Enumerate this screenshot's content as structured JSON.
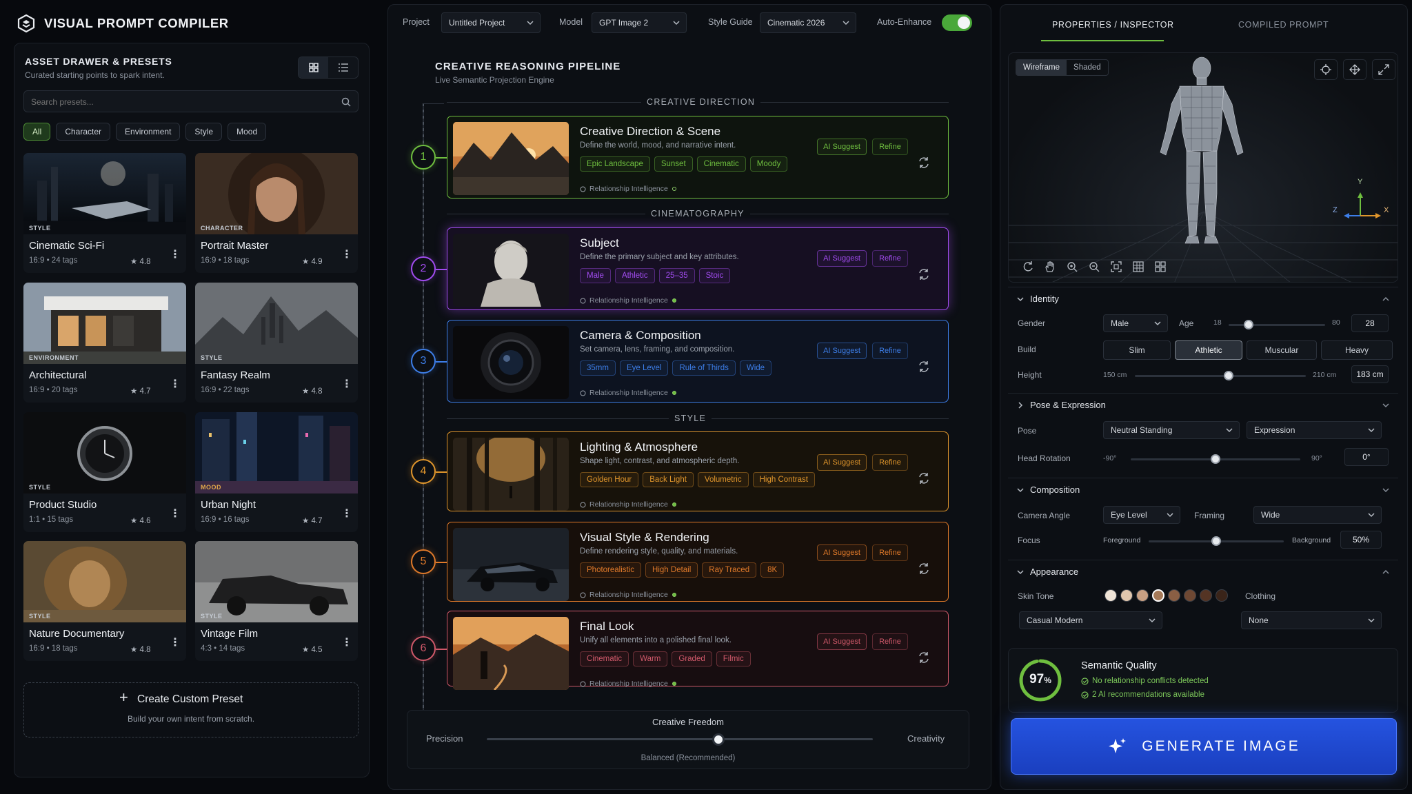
{
  "app": {
    "title": "VISUAL PROMPT COMPILER"
  },
  "drawer": {
    "title": "ASSET DRAWER & PRESETS",
    "subtitle": "Curated starting points to spark intent.",
    "search_placeholder": "Search presets...",
    "filters": [
      "All",
      "Character",
      "Environment",
      "Style",
      "Mood"
    ],
    "presets": [
      {
        "type": "STYLE",
        "title": "Cinematic Sci-Fi",
        "meta": "16:9  •  24 tags",
        "rating": "★ 4.8"
      },
      {
        "type": "CHARACTER",
        "title": "Portrait Master",
        "meta": "16:9  •  18 tags",
        "rating": "★ 4.9"
      },
      {
        "type": "ENVIRONMENT",
        "title": "Architectural",
        "meta": "16:9  •  20 tags",
        "rating": "★ 4.7"
      },
      {
        "type": "STYLE",
        "title": "Fantasy Realm",
        "meta": "16:9  •  22 tags",
        "rating": "★ 4.8"
      },
      {
        "type": "STYLE",
        "title": "Product Studio",
        "meta": "1:1  •  15 tags",
        "rating": "★ 4.6"
      },
      {
        "type": "MOOD",
        "title": "Urban Night",
        "meta": "16:9  •  16 tags",
        "rating": "★ 4.7"
      },
      {
        "type": "STYLE",
        "title": "Nature Documentary",
        "meta": "16:9  •  18 tags",
        "rating": "★ 4.8"
      },
      {
        "type": "STYLE",
        "title": "Vintage Film",
        "meta": "4:3  •  14 tags",
        "rating": "★ 4.5"
      }
    ],
    "create_title": "Create Custom Preset",
    "create_sub": "Build your own intent from scratch."
  },
  "topbar": {
    "project_label": "Project",
    "project_value": "Untitled Project",
    "model_label": "Model",
    "model_value": "GPT Image 2",
    "style_label": "Style Guide",
    "style_value": "Cinematic 2026",
    "auto_label": "Auto-Enhance",
    "auto_on": true
  },
  "pipeline": {
    "title": "CREATIVE REASONING PIPELINE",
    "subtitle": "Live Semantic Projection Engine",
    "sections": [
      "CREATIVE DIRECTION",
      "CINEMATOGRAPHY",
      "STYLE"
    ],
    "ai_label": "AI Suggest",
    "refine_label": "Refine",
    "rel_label": "Relationship Intelligence",
    "stages": [
      {
        "num": "1",
        "title": "Creative Direction & Scene",
        "desc": "Define the world, mood, and narrative intent.",
        "chips": [
          "Epic Landscape",
          "Sunset",
          "Cinematic",
          "Moody"
        ],
        "color": "#6fbf3f"
      },
      {
        "num": "2",
        "title": "Subject",
        "desc": "Define the primary subject and key attributes.",
        "chips": [
          "Male",
          "Athletic",
          "25–35",
          "Stoic"
        ],
        "color": "#a24cf0"
      },
      {
        "num": "3",
        "title": "Camera & Composition",
        "desc": "Set camera, lens, framing, and composition.",
        "chips": [
          "35mm",
          "Eye Level",
          "Rule of Thirds",
          "Wide"
        ],
        "color": "#3d7ee8"
      },
      {
        "num": "4",
        "title": "Lighting & Atmosphere",
        "desc": "Shape light, contrast, and atmospheric depth.",
        "chips": [
          "Golden Hour",
          "Back Light",
          "Volumetric",
          "High Contrast"
        ],
        "color": "#e0962c"
      },
      {
        "num": "5",
        "title": "Visual Style & Rendering",
        "desc": "Define rendering style, quality, and materials.",
        "chips": [
          "Photorealistic",
          "High Detail",
          "Ray Traced",
          "8K"
        ],
        "color": "#e07a2a"
      },
      {
        "num": "6",
        "title": "Final Look",
        "desc": "Unify all elements into a polished final look.",
        "chips": [
          "Cinematic",
          "Warm",
          "Graded",
          "Filmic"
        ],
        "color": "#d0596a"
      }
    ],
    "freedom": {
      "title": "Creative Freedom",
      "left": "Precision",
      "right": "Creativity",
      "value_label": "Balanced (Recommended)",
      "value": 0.6
    }
  },
  "inspector": {
    "tabs": [
      "PROPERTIES / INSPECTOR",
      "COMPILED PROMPT"
    ],
    "view_modes": [
      "Wireframe",
      "Shaded"
    ],
    "axes": {
      "y": "Y",
      "x": "X",
      "z": "Z"
    },
    "identity": {
      "title": "Identity",
      "gender_label": "Gender",
      "gender": "Male",
      "age_label": "Age",
      "age_min": "18",
      "age_max": "80",
      "age": "28",
      "age_value": 0.21,
      "build_label": "Build",
      "builds": [
        "Slim",
        "Athletic",
        "Muscular",
        "Heavy"
      ],
      "build_selected": "Athletic",
      "height_label": "Height",
      "height_min": "150 cm",
      "height_max": "210 cm",
      "height": "183 cm",
      "height_value": 0.55
    },
    "pose": {
      "title": "Pose & Expression",
      "pose_label": "Pose",
      "pose": "Neutral Standing",
      "expression": "Expression",
      "rot_label": "Head Rotation",
      "rot_min": "-90°",
      "rot_max": "90°",
      "rot": "0°",
      "rot_value": 0.5
    },
    "composition": {
      "title": "Composition",
      "angle_label": "Camera Angle",
      "angle": "Eye Level",
      "framing_label": "Framing",
      "framing": "Wide",
      "focus_label": "Focus",
      "focus_left": "Foreground",
      "focus_right": "Background",
      "focus": "50%",
      "focus_value": 0.5
    },
    "appearance": {
      "title": "Appearance",
      "skin_label": "Skin Tone",
      "skin_colors": [
        "#efe3d6",
        "#e0c6ad",
        "#c9a083",
        "#a67a58",
        "#8a5f44",
        "#6e4833",
        "#543424",
        "#3a2419"
      ],
      "skin_selected": 3,
      "clothing_label": "Clothing",
      "clothing_style": "Casual Modern",
      "clothing_value": "None"
    },
    "quality": {
      "percent": "97",
      "unit": "%",
      "value": 0.97,
      "title": "Semantic Quality",
      "line1": "No relationship conflicts detected",
      "line2": "2 AI recommendations available"
    },
    "generate_label": "GENERATE IMAGE"
  }
}
